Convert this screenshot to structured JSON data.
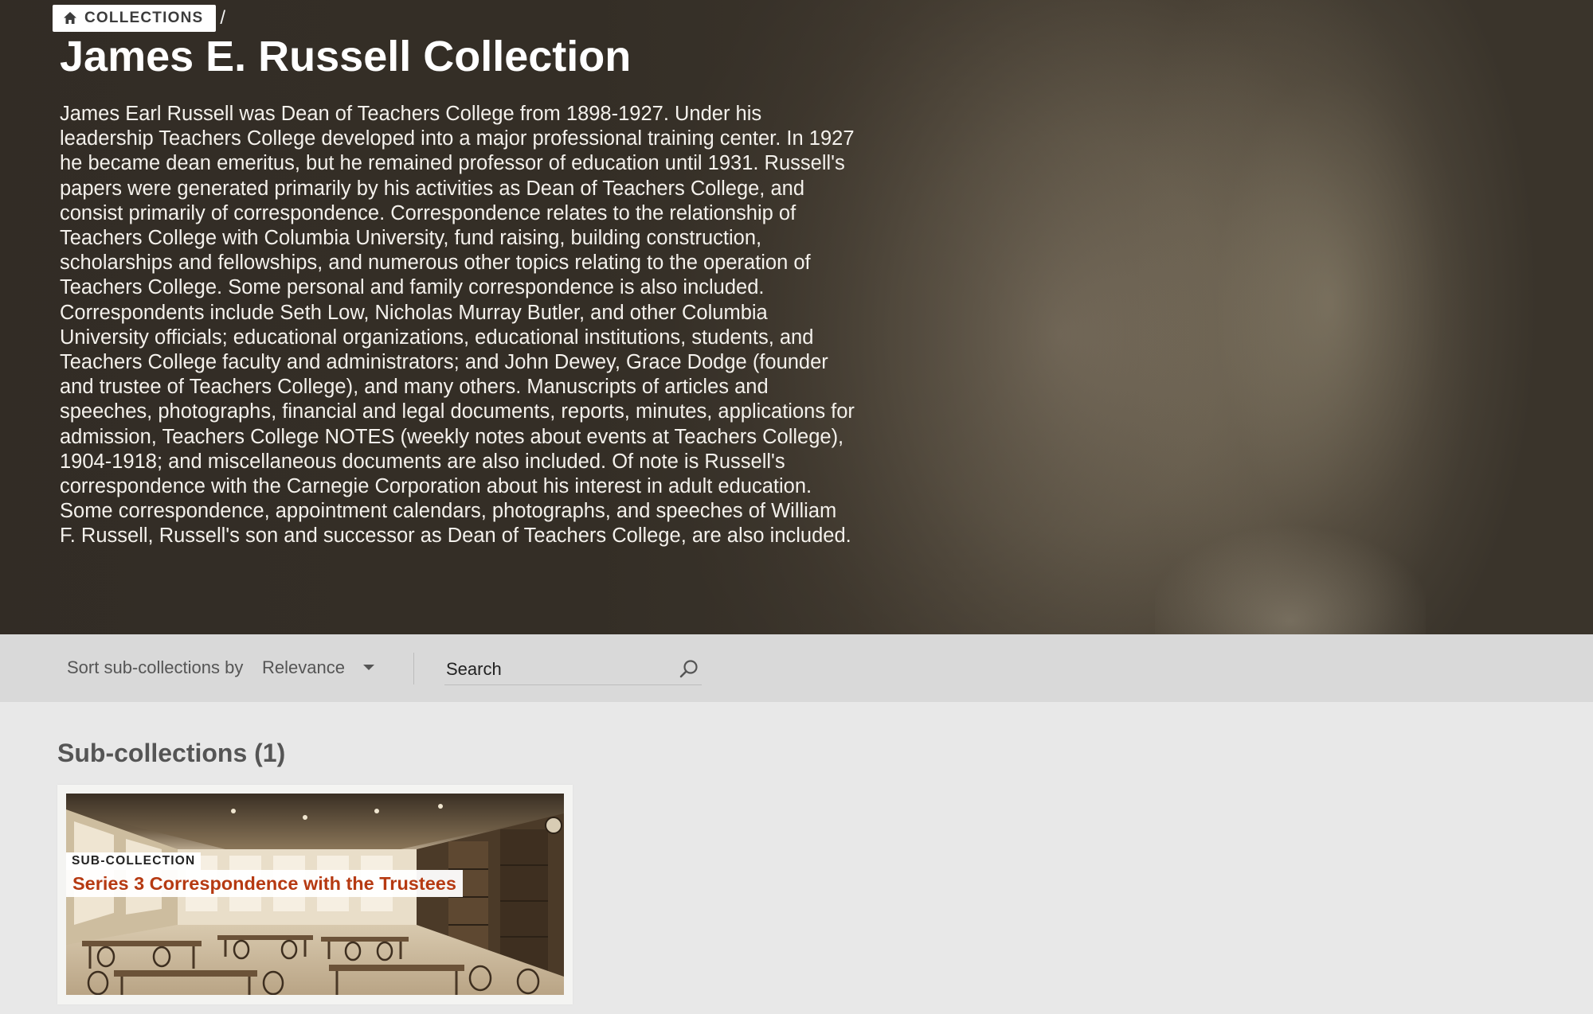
{
  "breadcrumb": {
    "home_icon": "home-icon",
    "label": "COLLECTIONS",
    "separator": "/"
  },
  "collection": {
    "title": "James E. Russell Collection",
    "description": "James Earl Russell was Dean of Teachers College from 1898-1927. Under his leadership Teachers College developed into a major professional training center. In 1927 he became dean emeritus, but he remained professor of education until 1931. Russell's papers were generated primarily by his activities as Dean of Teachers College, and consist primarily of correspondence. Correspondence relates to the relationship of Teachers College with Columbia University, fund raising, building construction, scholarships and fellowships, and numerous other topics relating to the operation of Teachers College. Some personal and family correspondence is also included. Correspondents include Seth Low, Nicholas Murray Butler, and other Columbia University officials; educational organizations, educational institutions, students, and Teachers College faculty and administrators; and John Dewey, Grace Dodge (founder and trustee of Teachers College), and many others. Manuscripts of articles and speeches, photographs, financial and legal documents, reports, minutes, applications for admission, Teachers College NOTES (weekly notes about events at Teachers College), 1904-1918; and miscellaneous documents are also included. Of note is Russell's correspondence with the Carnegie Corporation about his interest in adult education. Some correspondence, appointment calendars, photographs, and speeches of William F. Russell, Russell's son and successor as Dean of Teachers College, are also included."
  },
  "toolbar": {
    "sort_label": "Sort sub-collections by",
    "sort_value": "Relevance",
    "sort_icon": "chevron-down-icon",
    "search_placeholder": "Search",
    "search_icon": "search-icon"
  },
  "subcollections": {
    "heading": "Sub-collections (1)",
    "items": [
      {
        "tag": "SUB-COLLECTION",
        "title": "Series 3 Correspondence with the Trustees",
        "image": "library-reading-room-photo"
      }
    ]
  },
  "colors": {
    "title_accent": "#b63a12",
    "toolbar_bg": "#d9d9d9",
    "page_bg": "#e8e8e8",
    "hero_text": "#ffffff"
  }
}
